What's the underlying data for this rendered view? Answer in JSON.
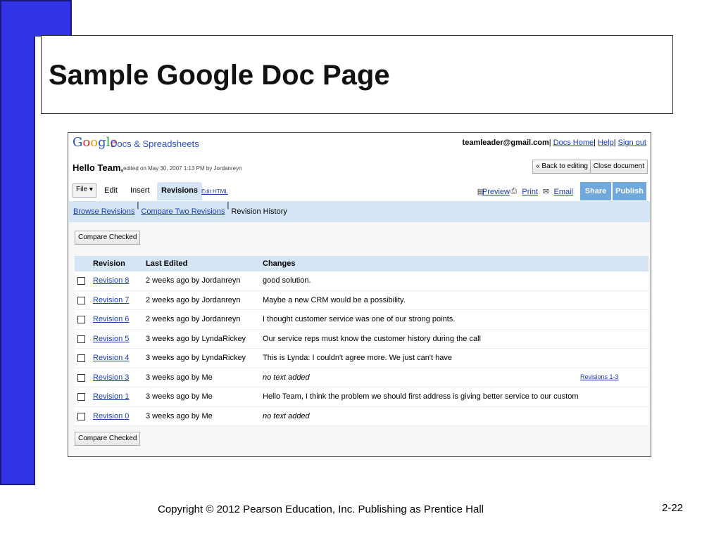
{
  "slide": {
    "title": "Sample Google Doc Page",
    "footer": "Copyright © 2012 Pearson Education, Inc. Publishing as Prentice Hall",
    "page_number": "2-22"
  },
  "app": {
    "logo_letters": [
      "G",
      "o",
      "o",
      "g",
      "l",
      "e"
    ],
    "name": "Docs & Spreadsheets",
    "account_email": "teamleader@gmail.com",
    "links": [
      "Docs Home",
      "Help",
      "Sign out"
    ]
  },
  "doc": {
    "title": "Hello Team,",
    "meta": "edited on May 30, 2007 1:13 PM by Jordanreyn",
    "back_button": "« Back to editing",
    "close_button": "Close document"
  },
  "tabs": {
    "file": "File ▾",
    "edit": "Edit",
    "insert": "Insert",
    "revisions": "Revisions",
    "edit_html": "Edit HTML"
  },
  "toolbar": {
    "preview": "Preview",
    "print": "Print",
    "email": "Email",
    "share": "Share",
    "publish": "Publish"
  },
  "subnav": {
    "browse": "Browse Revisions",
    "compare": "Compare Two Revisions",
    "history": "Revision History"
  },
  "compare_button": "Compare Checked",
  "table": {
    "headers": [
      "Revision",
      "Last Edited",
      "Changes"
    ],
    "rows": [
      {
        "rev": "Revision 8",
        "edited": "2 weeks ago by Jordanreyn",
        "changes": "good solution.",
        "italic": false,
        "extra": ""
      },
      {
        "rev": "Revision 7",
        "edited": "2 weeks ago by Jordanreyn",
        "changes": "Maybe a new CRM would be a possibility.",
        "italic": false,
        "extra": ""
      },
      {
        "rev": "Revision 6",
        "edited": "2 weeks ago by Jordanreyn",
        "changes": "I thought customer service was one of our strong points.",
        "italic": false,
        "extra": ""
      },
      {
        "rev": "Revision 5",
        "edited": "3 weeks ago by LyndaRickey",
        "changes": "Our service reps must know the customer history during the call",
        "italic": false,
        "extra": ""
      },
      {
        "rev": "Revision 4",
        "edited": "3 weeks ago by LyndaRickey",
        "changes": "This is Lynda: I couldn't agree more. We just can't have",
        "italic": false,
        "extra": ""
      },
      {
        "rev": "Revision 3",
        "edited": "3 weeks ago by Me",
        "changes": "no text added",
        "italic": true,
        "extra": "Revisions 1-3"
      },
      {
        "rev": "Revision 1",
        "edited": "3 weeks ago by Me",
        "changes": "Hello Team, I think the problem we should first address is giving better service to our customers. What d",
        "italic": false,
        "extra": ""
      },
      {
        "rev": "Revision 0",
        "edited": "3 weeks ago by Me",
        "changes": "no text added",
        "italic": true,
        "extra": ""
      }
    ]
  },
  "icons": {
    "preview": "preview-icon",
    "print": "print-icon",
    "email": "email-icon"
  }
}
